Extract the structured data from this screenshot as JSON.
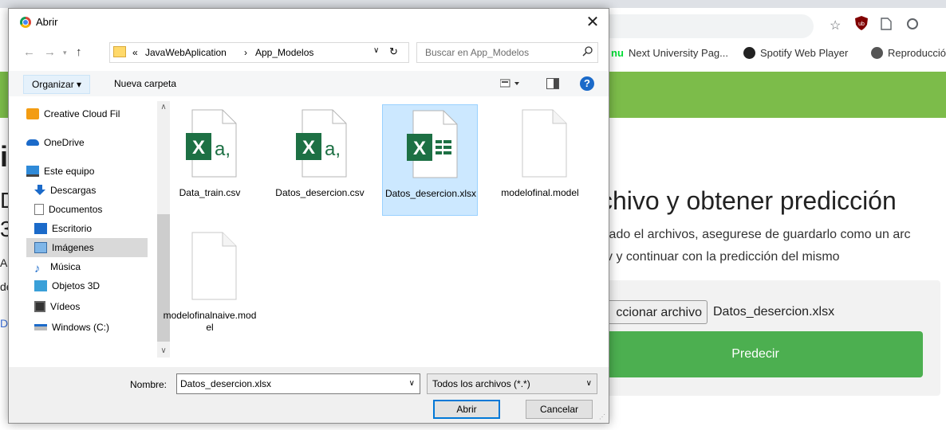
{
  "browser": {
    "bookmarks": [
      {
        "label": "Next University Pag...",
        "icon": "next-university-icon"
      },
      {
        "label": "Spotify Web Player",
        "icon": "spotify-icon"
      },
      {
        "label": "Reproducció",
        "icon": "globe-icon"
      }
    ],
    "bookmark_prefix": "nu",
    "page": {
      "heading": "chivo y obtener predicción",
      "paragraph_line1": "ciado el archivos, asegurese de guardarlo como un arc",
      "paragraph_line2": "sv y continuar con la predicción del mismo",
      "file_button": "ccionar archivo",
      "file_name": "Datos_desercion.xlsx",
      "predict_button": "Predecir",
      "left_fragments": [
        "i",
        "D",
        "3",
        "A",
        "de",
        "Dı"
      ]
    },
    "colors": {
      "green_band": "#7cbc4a",
      "predict_button": "#4caf50"
    }
  },
  "dialog": {
    "title": "Abrir",
    "breadcrumb": {
      "overflow": "«",
      "parts": [
        "JavaWebAplication",
        "App_Modelos"
      ],
      "separator": "›"
    },
    "search_placeholder": "Buscar en App_Modelos",
    "toolbar": {
      "organize": "Organizar ▾",
      "new_folder": "Nueva carpeta"
    },
    "nav_items": [
      {
        "label": "Creative Cloud Fil",
        "icon": "creative-cloud-icon"
      },
      {
        "label": "OneDrive",
        "icon": "onedrive-icon"
      },
      {
        "label": "Este equipo",
        "icon": "computer-icon"
      },
      {
        "label": "Descargas",
        "icon": "downloads-icon"
      },
      {
        "label": "Documentos",
        "icon": "documents-icon"
      },
      {
        "label": "Escritorio",
        "icon": "desktop-icon"
      },
      {
        "label": "Imágenes",
        "icon": "pictures-icon",
        "selected": true
      },
      {
        "label": "Música",
        "icon": "music-icon"
      },
      {
        "label": "Objetos 3D",
        "icon": "objects-3d-icon"
      },
      {
        "label": "Vídeos",
        "icon": "videos-icon"
      },
      {
        "label": "Windows (C:)",
        "icon": "drive-icon"
      }
    ],
    "files": [
      {
        "name": "Data_train.csv",
        "type": "csv"
      },
      {
        "name": "Datos_desercion.csv",
        "type": "csv"
      },
      {
        "name": "Datos_desercion.xlsx",
        "type": "xlsx",
        "selected": true
      },
      {
        "name": "modelofinal.model",
        "type": "model"
      },
      {
        "name": "modelofinalnaive.model",
        "type": "model"
      }
    ],
    "filename_label": "Nombre:",
    "filename_value": "Datos_desercion.xlsx",
    "filetype_value": "Todos los archivos (*.*)",
    "open_button": "Abrir",
    "cancel_button": "Cancelar",
    "colors": {
      "excel_green": "#1d7044",
      "selection": "#cce8ff",
      "accent": "#0078d7"
    }
  }
}
